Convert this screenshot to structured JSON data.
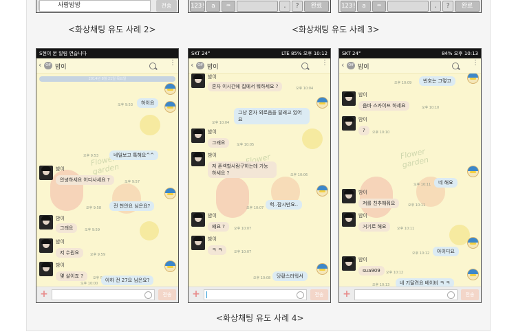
{
  "captions": {
    "case2": "<화상채팅 유도 사례 2>",
    "case3": "<화상채팅 유도 사례 3>",
    "case4": "<화상채팅 유도 사례 4>"
  },
  "top_cropped": {
    "left_input_text": "사랑방방",
    "left_send": "전송",
    "keys": [
      "123!",
      "a",
      "⌨",
      "",
      ".",
      "?",
      "완료"
    ]
  },
  "phones": [
    {
      "status_left": "S현이 본 알림 연습니다",
      "status_right": "",
      "title": "밤이",
      "date_bar": "2014년 8월 21일 목요일",
      "send_label": "전송",
      "messages": [
        {
          "side": "out",
          "text": "하이요",
          "time": "오후 9:53"
        },
        {
          "side": "out",
          "text": "네일보고 톡해요^^",
          "time": "오후 9:53"
        },
        {
          "side": "in",
          "sender": "밤이",
          "text": "안녕하세요 어디사세요 ?",
          "time": "오후 9:57"
        },
        {
          "side": "out",
          "text": "전 천안요 님은요?",
          "time": "오후 9:58"
        },
        {
          "side": "in",
          "sender": "밤이",
          "text": "그래요",
          "time": "오후 9:59"
        },
        {
          "side": "in",
          "sender": "밤이",
          "text": "저 수원요",
          "time": "오후 9:59"
        },
        {
          "side": "in",
          "sender": "밤이",
          "text": "몇 살이죠 ?",
          "time": "오후 9:59"
        },
        {
          "side": "out",
          "text": "아하 전 27요 님은요?",
          "time": "오후 10:00"
        }
      ]
    },
    {
      "status_left": "SKT 24°",
      "status_right": "LTE 85% 오후 10:12",
      "title": "밤이",
      "send_label": "전송",
      "messages": [
        {
          "side": "in",
          "sender": "밤이",
          "text": "혼자 이시간에 집에서 뭐하세요 ?",
          "time": "오후 10:04"
        },
        {
          "side": "out",
          "text": "그냥 혼자 외로움을 달래고 있어요",
          "time": "오후 10:04"
        },
        {
          "side": "in",
          "sender": "밤이",
          "text": "그래요",
          "time": "오후 10:05"
        },
        {
          "side": "in",
          "sender": "밤이",
          "text": "저 폰섹할사람구하는데 가능하세요 ?",
          "time": "오후 10:06"
        },
        {
          "side": "out",
          "text": "헉..잠시만요..",
          "time": "오후 10:07"
        },
        {
          "side": "in",
          "sender": "밤이",
          "text": "왜요 ?",
          "time": "오후 10:07"
        },
        {
          "side": "in",
          "sender": "밤이",
          "text": "ㅋ ㅋ",
          "time": "오후 10:07"
        },
        {
          "side": "out",
          "text": "당황스러워서",
          "time": "오후 10:08"
        }
      ]
    },
    {
      "status_left": "SKT 24°",
      "status_right": "84% 오후 10:13",
      "title": "밤이",
      "send_label": "전송",
      "messages": [
        {
          "side": "out",
          "text": "번호는 그렇고",
          "time": "오후 10:09"
        },
        {
          "side": "in",
          "sender": "밤이",
          "text": "음바 스카이프 하세요",
          "time": "오후 10:10"
        },
        {
          "side": "in",
          "sender": "밤이",
          "text": "?",
          "time": "오후 10:10"
        },
        {
          "side": "out",
          "text": "네 해요",
          "time": "오후 10:11"
        },
        {
          "side": "in",
          "sender": "밤이",
          "text": "저를 친추해줘요",
          "time": "오후 10:11"
        },
        {
          "side": "in",
          "sender": "밤이",
          "text": "거기로 해요",
          "time": "오후 10:11"
        },
        {
          "side": "out",
          "text": "아이디요",
          "time": "오후 10:12"
        },
        {
          "side": "in",
          "sender": "밤이",
          "text": "sua909",
          "time": "오후 10:12"
        },
        {
          "side": "out",
          "text": "네 기달려요 베이비 ㅋ ㅋ",
          "time": "오후 10:13"
        }
      ]
    }
  ]
}
